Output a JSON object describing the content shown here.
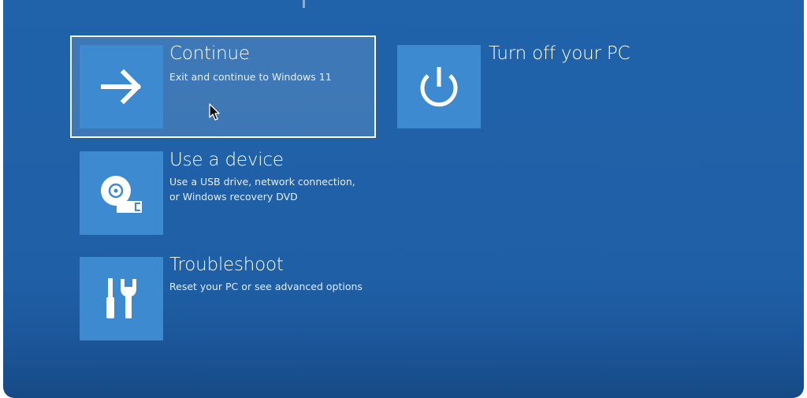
{
  "options": [
    {
      "id": "continue",
      "title": "Continue",
      "desc": "Exit and continue to Windows 11",
      "icon": "arrow-right-icon",
      "selected": true
    },
    {
      "id": "use-device",
      "title": "Use a device",
      "desc_lines": [
        "Use a USB drive, network connection,",
        "or Windows recovery DVD"
      ],
      "icon": "usb-disc-icon"
    },
    {
      "id": "troubleshoot",
      "title": "Troubleshoot",
      "desc": "Reset your PC or see advanced options",
      "icon": "tools-icon"
    },
    {
      "id": "turn-off",
      "title": "Turn off your PC",
      "icon": "power-icon"
    }
  ],
  "colors": {
    "background": "#2063ab",
    "tile": "#3d8ad0",
    "selected_border": "#ffffff",
    "text": "#ffffff"
  },
  "cursor": "mouse-pointer-icon"
}
